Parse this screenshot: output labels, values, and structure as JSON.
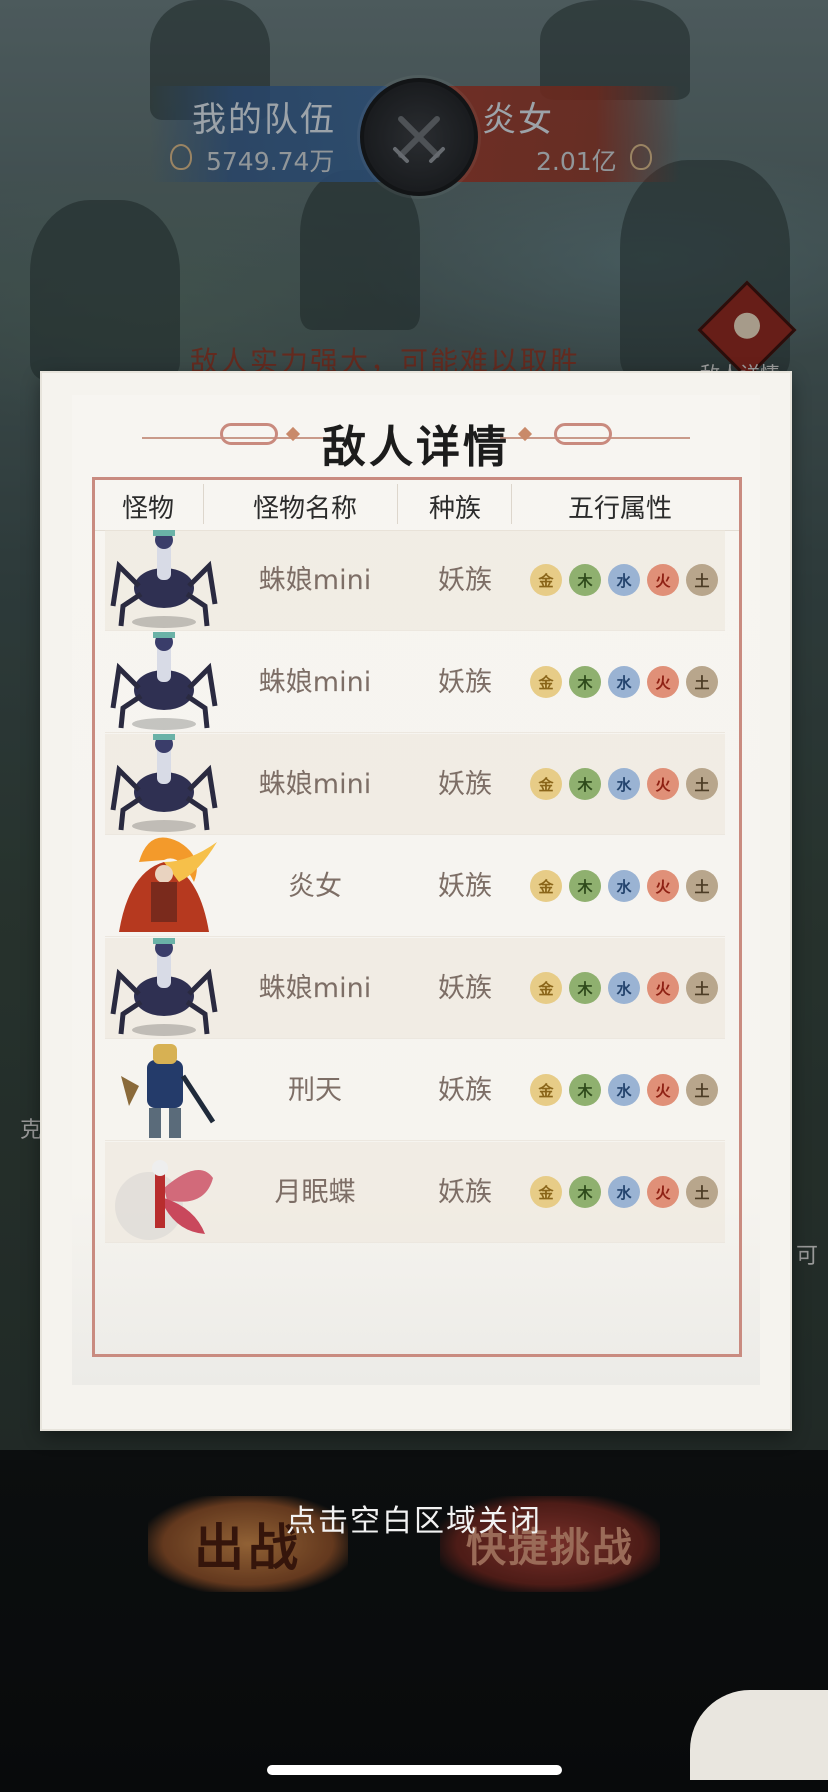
{
  "header": {
    "my_team_label": "我的队伍",
    "my_team_power": "5749.74万",
    "enemy_name": "炎女",
    "enemy_power": "2.01亿"
  },
  "background": {
    "warning": "敌人实力强大，可能难以取胜",
    "enemy_detail_button": "敌人详情",
    "side_left": "克",
    "side_right": "可"
  },
  "modal": {
    "title": "敌人详情",
    "columns": [
      "怪物",
      "怪物名称",
      "种族",
      "五行属性"
    ],
    "element_labels": [
      "金",
      "木",
      "水",
      "火",
      "土"
    ],
    "rows": [
      {
        "name": "蛛娘mini",
        "race": "妖族",
        "portrait": "spider-girl"
      },
      {
        "name": "蛛娘mini",
        "race": "妖族",
        "portrait": "spider-girl"
      },
      {
        "name": "蛛娘mini",
        "race": "妖族",
        "portrait": "spider-girl"
      },
      {
        "name": "炎女",
        "race": "妖族",
        "portrait": "flame-woman"
      },
      {
        "name": "蛛娘mini",
        "race": "妖族",
        "portrait": "spider-girl"
      },
      {
        "name": "刑天",
        "race": "妖族",
        "portrait": "xingtian"
      },
      {
        "name": "月眠蝶",
        "race": "妖族",
        "portrait": "moon-butterfly"
      }
    ]
  },
  "footer": {
    "close_hint": "点击空白区域关闭",
    "fight_button": "出战",
    "quick_challenge_button": "快捷挑战"
  },
  "colors": {
    "frame": "#c98b80",
    "text_muted": "#7d6e66",
    "gold": "#e7cc87",
    "wood": "#8fb06f",
    "water": "#9ab3d3",
    "fire": "#e09078",
    "earth": "#b8a68c"
  }
}
